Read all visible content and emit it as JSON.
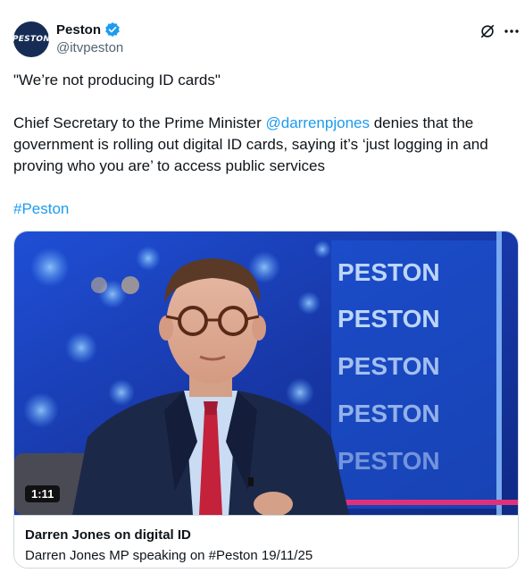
{
  "author": {
    "avatar_text": "PESTON",
    "display_name": "Peston",
    "handle": "@itvpeston",
    "verified": true
  },
  "tweet": {
    "line1": "\"We’re not producing ID cards\"",
    "body_prefix": "Chief Secretary to the Prime Minister ",
    "mention": "@darrenpjones",
    "body_suffix": " denies that the government is rolling out digital ID cards, saying it’s ‘just logging in and proving who you are’ to access public services",
    "hashtag": "#Peston"
  },
  "video_card": {
    "duration": "1:11",
    "title": "Darren Jones on digital ID",
    "description": "Darren Jones MP speaking on #Peston 19/11/25",
    "backdrop_logo_text": "PESTON"
  },
  "icons": {
    "verified": "verified-badge-icon",
    "x_logo": "x-logo-icon",
    "more": "more-icon"
  },
  "colors": {
    "link": "#1d9bf0",
    "verified": "#1d9bf0",
    "avatar_bg": "#162c55",
    "backdrop": "#1a3fb8"
  }
}
